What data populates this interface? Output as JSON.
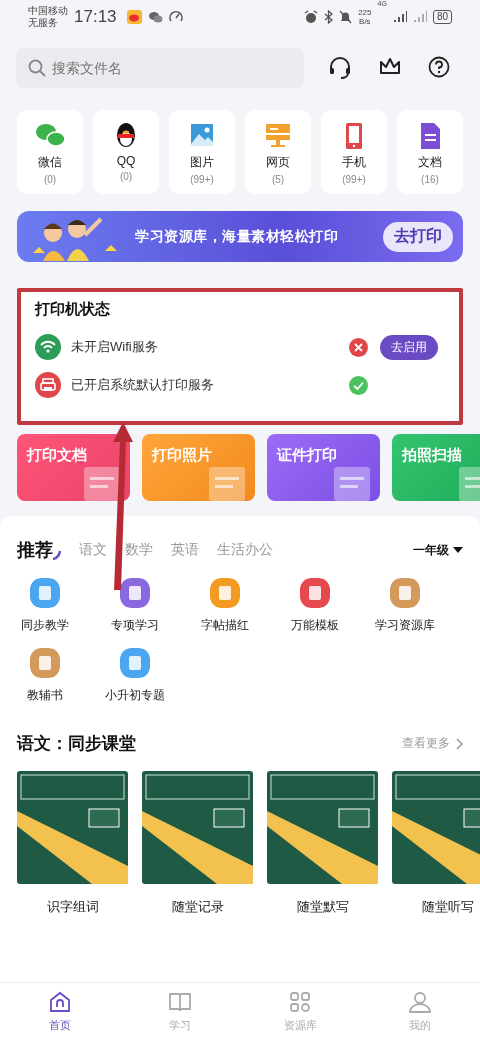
{
  "status_bar": {
    "carrier": "中国移动",
    "service": "无服务",
    "time": "17:13",
    "net_speed": "225",
    "net_unit": "B/s",
    "network": "4G",
    "battery": "80"
  },
  "search": {
    "placeholder": "搜索文件名"
  },
  "categories": [
    {
      "label": "微信",
      "count": "(0)",
      "kind": "wechat"
    },
    {
      "label": "QQ",
      "count": "(0)",
      "kind": "qq"
    },
    {
      "label": "图片",
      "count": "(99+)",
      "kind": "image"
    },
    {
      "label": "网页",
      "count": "(5)",
      "kind": "web"
    },
    {
      "label": "手机",
      "count": "(99+)",
      "kind": "phone"
    },
    {
      "label": "文档",
      "count": "(16)",
      "kind": "doc"
    }
  ],
  "banner": {
    "text": "学习资源库，海量素材轻松打印",
    "button": "去打印"
  },
  "printer_status": {
    "title": "打印机状态",
    "items": [
      {
        "kind": "wifi",
        "label": "未开启Wifi服务",
        "on": false,
        "action": "去启用"
      },
      {
        "kind": "printer",
        "label": "已开启系统默认打印服务",
        "on": true
      }
    ]
  },
  "functions": [
    {
      "label": "打印文档",
      "kind": "document"
    },
    {
      "label": "打印照片",
      "kind": "photo"
    },
    {
      "label": "证件打印",
      "kind": "id-card"
    },
    {
      "label": "拍照扫描",
      "kind": "scan"
    }
  ],
  "subject_tabs": [
    {
      "label": "推荐",
      "selected": true
    },
    {
      "label": "语文",
      "selected": false
    },
    {
      "label": "数学",
      "selected": false
    },
    {
      "label": "英语",
      "selected": false
    },
    {
      "label": "生活办公",
      "selected": false
    }
  ],
  "grade": "一年级",
  "tools": [
    {
      "label": "同步教学",
      "kind": "sync"
    },
    {
      "label": "专项学习",
      "kind": "special"
    },
    {
      "label": "字帖描红",
      "kind": "copybook"
    },
    {
      "label": "万能模板",
      "kind": "template"
    },
    {
      "label": "学习资源库",
      "kind": "library"
    },
    {
      "label": "教辅书",
      "kind": "book"
    },
    {
      "label": "小升初专题",
      "kind": "topic"
    }
  ],
  "course_section": {
    "title": "语文：同步课堂",
    "more": "查看更多",
    "items": [
      {
        "label": "识字组词"
      },
      {
        "label": "随堂记录"
      },
      {
        "label": "随堂默写"
      },
      {
        "label": "随堂听写"
      }
    ]
  },
  "bottom_nav": [
    {
      "label": "首页",
      "kind": "home",
      "selected": true
    },
    {
      "label": "学习",
      "kind": "study",
      "selected": false
    },
    {
      "label": "资源库",
      "kind": "library",
      "selected": false
    },
    {
      "label": "我的",
      "kind": "me",
      "selected": false
    }
  ]
}
